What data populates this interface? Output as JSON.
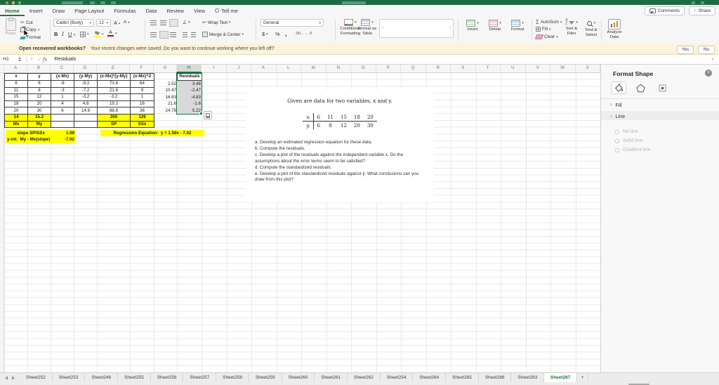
{
  "colors": {
    "excel_green": "#217346",
    "titlebar_green": "#1d6b42",
    "highlight_yellow": "#ffff00",
    "selection_gray": "#d9d9d9",
    "selection_border": "#1a7340",
    "notification_bg": "#fbf4da"
  },
  "ribbon": {
    "active_tab": "Home",
    "tabs": [
      "Home",
      "Insert",
      "Draw",
      "Page Layout",
      "Formulas",
      "Data",
      "Review",
      "View",
      "Tell me"
    ],
    "comments_label": "Comments",
    "share_label": "Share",
    "clipboard": {
      "paste": "Paste",
      "cut": "Cut",
      "copy": "Copy",
      "format": "Format"
    },
    "font": {
      "name": "Calibri (Body)",
      "size": "12",
      "bold": "B",
      "italic": "I",
      "underline": "U",
      "grow": "A",
      "shrink": "A",
      "color": "A"
    },
    "alignment": {
      "wrap_text": "Wrap Text",
      "merge_center": "Merge & Center"
    },
    "number": {
      "format": "General",
      "currency": "$",
      "percent": "%",
      "comma": ",",
      "inc_dec": ".00",
      "dec_dec": ".0"
    },
    "styles": {
      "conditional_formatting": "Conditional Formatting",
      "format_as_table": "Format as Table"
    },
    "cells": {
      "insert": "Insert",
      "delete": "Delete",
      "format": "Format"
    },
    "editing": {
      "autosum": "AutoSum",
      "sigma": "Σ",
      "fill": "Fill",
      "clear": "Clear",
      "sort_filter": "Sort & Filter",
      "find_select": "Find & Select",
      "analyze_data": "Analyze Data"
    }
  },
  "notification": {
    "question": "Open recovered workbooks?",
    "message": "Your recent changes were saved. Do you want to continue working where you left off?",
    "yes_label": "Yes",
    "no_label": "No"
  },
  "formula_bar": {
    "cell_ref": "H1",
    "fx_label": "fx",
    "value": "Residuals"
  },
  "sheet": {
    "columns": [
      "A",
      "B",
      "C",
      "D",
      "E",
      "F",
      "G",
      "H",
      "I",
      "J",
      "K",
      "L",
      "M",
      "N",
      "O",
      "P",
      "Q",
      "R",
      "S",
      "T",
      "U",
      "V",
      "W",
      "X"
    ],
    "selected_column": "H",
    "table": {
      "headers": [
        "x",
        "y",
        "(x-Mx)",
        "(y-My)",
        "(x-Mx)*(y-My)",
        "(x-Mx)^2",
        "",
        "Residuals"
      ],
      "rows": [
        [
          "6",
          "6",
          "-8",
          "-9.2",
          "73.6",
          "64",
          "2.52",
          "3.48"
        ],
        [
          "11",
          "8",
          "-3",
          "-7.2",
          "21.6",
          "9",
          "10.47",
          "-2.47"
        ],
        [
          "15",
          "12",
          "1",
          "-3.2",
          "-3.2",
          "1",
          "16.83",
          "-4.83"
        ],
        [
          "18",
          "20",
          "4",
          "4.8",
          "19.2",
          "16",
          "21.6",
          "-1.6"
        ],
        [
          "20",
          "30",
          "6",
          "14.8",
          "88.8",
          "36",
          "24.78",
          "5.22"
        ]
      ],
      "means_row": [
        "14",
        "15.2",
        "",
        "",
        "200",
        "126"
      ],
      "labels_row": [
        "Mx",
        "My",
        "",
        "",
        "SP",
        "SSx"
      ],
      "slope_label": "slope SP/SSx",
      "slope_value": "1.59",
      "yint_label": "y-int:  My - Mx(slope)",
      "yint_value": "-7.02",
      "regression_equation": "Regression Equation:  y = 1.59x - 7.02"
    },
    "textbox": {
      "title": "Given are data for two variables, x and y.",
      "x_label": "xᵢ",
      "y_label": "yᵢ",
      "x_values": [
        "6",
        "11",
        "15",
        "18",
        "20"
      ],
      "y_values": [
        "6",
        "8",
        "12",
        "20",
        "30"
      ],
      "items": [
        "a. Develop an estimated regression equation for these data.",
        "b. Compute the residuals.",
        "c. Develop a plot of the residuals against the independent variable x. Do the assumptions about the error terms seem to be satisfied?",
        "d. Compute the standardized residuals.",
        "e. Develop a plot of the standardized residuals against ŷ. What conclusions can you draw from this plot?"
      ]
    }
  },
  "format_panel": {
    "title": "Format Shape",
    "fill_section": "Fill",
    "line_section": "Line",
    "line_options": [
      "No line",
      "Solid line",
      "Gradient line"
    ]
  },
  "sheet_tabs": {
    "tabs": [
      "Sheet252",
      "Sheet253",
      "Sheet246",
      "Sheet255",
      "Sheet256",
      "Sheet257",
      "Sheet258",
      "Sheet259",
      "Sheet260",
      "Sheet261",
      "Sheet262",
      "Sheet254",
      "Sheet264",
      "Sheet265",
      "Sheet266",
      "Sheet263",
      "Sheet267"
    ],
    "active": "Sheet267",
    "add_label": "+"
  }
}
